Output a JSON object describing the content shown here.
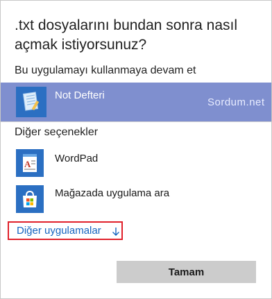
{
  "dialog": {
    "title": ".txt dosyalarını bundan sonra nasıl açmak istiyorsunuz?",
    "continue_section": "Bu uygulamayı kullanmaya devam et",
    "other_section": "Diğer seçenekler",
    "watermark": "Sordum.net",
    "apps": {
      "selected": {
        "label": "Not Defteri",
        "icon": "notepad-icon"
      },
      "wordpad": {
        "label": "WordPad",
        "icon": "wordpad-icon"
      },
      "store": {
        "label": "Mağazada uygulama ara",
        "icon": "store-icon"
      }
    },
    "more_apps_label": "Diğer uygulamalar",
    "more_apps_icon": "arrow-down-icon",
    "ok_label": "Tamam"
  },
  "colors": {
    "selected_row": "#7f8fcf",
    "icon_tile": "#2b6fc2",
    "link": "#1464c0",
    "highlight_border": "#e0202a",
    "button": "#cccccc"
  }
}
